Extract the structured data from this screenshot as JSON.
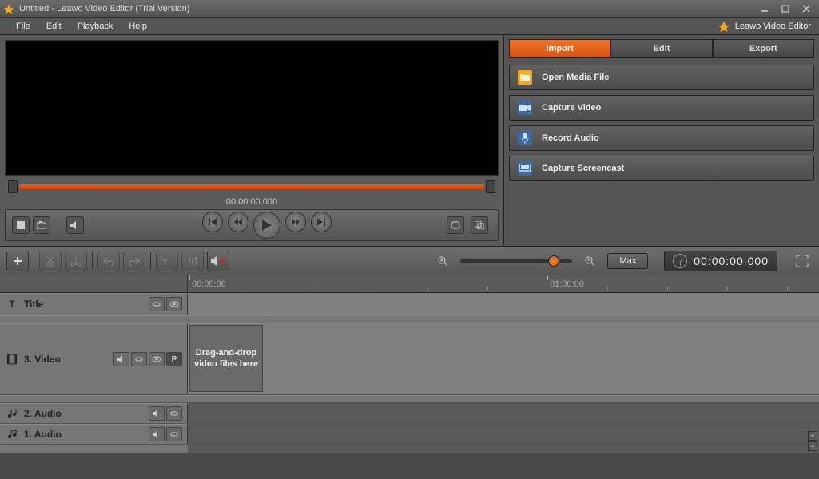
{
  "window": {
    "title": "Untitled - Leawo Video Editor (Trial Version)"
  },
  "menu": {
    "file": "File",
    "edit": "Edit",
    "playback": "Playback",
    "help": "Help"
  },
  "brand": "Leawo Video Editor",
  "preview": {
    "timecode": "00:00:00.000"
  },
  "tabs": {
    "import": "Import",
    "edit": "Edit",
    "export": "Export"
  },
  "actions": {
    "open": "Open Media File",
    "capture_video": "Capture Video",
    "record_audio": "Record Audio",
    "capture_screencast": "Capture Screencast"
  },
  "toolbar": {
    "max": "Max",
    "clock": "00:00:00.000"
  },
  "ruler": {
    "t0": "00:00:00",
    "t1": "01:00:00"
  },
  "tracks": {
    "title": "Title",
    "video": "3. Video",
    "audio2": "2. Audio",
    "audio1": "1. Audio",
    "drop_hint": "Drag-and-drop video files here",
    "p_badge": "P"
  }
}
